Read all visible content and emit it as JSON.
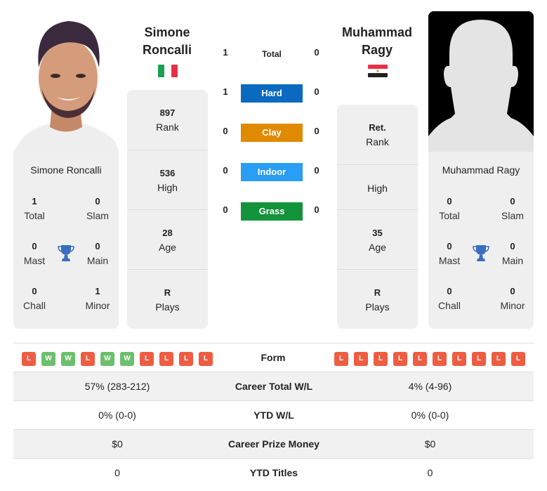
{
  "player1": {
    "name_line1": "Simone",
    "name_line2": "Roncalli",
    "full_name": "Simone Roncalli",
    "flag": "italy-flag",
    "photo": "player-photo",
    "rank": {
      "value": "897",
      "label": "Rank"
    },
    "high": {
      "value": "536",
      "label": "High"
    },
    "age": {
      "value": "28",
      "label": "Age"
    },
    "plays": {
      "value": "R",
      "label": "Plays"
    },
    "titles": {
      "total": {
        "value": "1",
        "label": "Total"
      },
      "slam": {
        "value": "0",
        "label": "Slam"
      },
      "mast": {
        "value": "0",
        "label": "Mast"
      },
      "main": {
        "value": "0",
        "label": "Main"
      },
      "chall": {
        "value": "0",
        "label": "Chall"
      },
      "minor": {
        "value": "1",
        "label": "Minor"
      }
    },
    "form": [
      "L",
      "W",
      "W",
      "L",
      "W",
      "W",
      "L",
      "L",
      "L",
      "L"
    ]
  },
  "player2": {
    "name_line1": "Muhammad",
    "name_line2": "Ragy",
    "full_name": "Muhammad Ragy",
    "flag": "egypt-flag",
    "photo": "silhouette-placeholder",
    "rank": {
      "value": "Ret.",
      "label": "Rank"
    },
    "high": {
      "value": "",
      "label": "High"
    },
    "age": {
      "value": "35",
      "label": "Age"
    },
    "plays": {
      "value": "R",
      "label": "Plays"
    },
    "titles": {
      "total": {
        "value": "0",
        "label": "Total"
      },
      "slam": {
        "value": "0",
        "label": "Slam"
      },
      "mast": {
        "value": "0",
        "label": "Mast"
      },
      "main": {
        "value": "0",
        "label": "Main"
      },
      "chall": {
        "value": "0",
        "label": "Chall"
      },
      "minor": {
        "value": "0",
        "label": "Minor"
      }
    },
    "form": [
      "L",
      "L",
      "L",
      "L",
      "L",
      "L",
      "L",
      "L",
      "L",
      "L"
    ]
  },
  "h2h": {
    "total": {
      "label": "Total",
      "p1": "1",
      "p2": "0"
    },
    "surfaces": [
      {
        "label": "Hard",
        "p1": "1",
        "p2": "0",
        "color": "#0a6abf"
      },
      {
        "label": "Clay",
        "p1": "0",
        "p2": "0",
        "color": "#e08a00"
      },
      {
        "label": "Indoor",
        "p1": "0",
        "p2": "0",
        "color": "#2a9df4"
      },
      {
        "label": "Grass",
        "p1": "0",
        "p2": "0",
        "color": "#13943a"
      }
    ]
  },
  "form_label": "Form",
  "comparison": [
    {
      "label": "Career Total W/L",
      "p1": "57% (283-212)",
      "p2": "4% (4-96)"
    },
    {
      "label": "YTD W/L",
      "p1": "0% (0-0)",
      "p2": "0% (0-0)"
    },
    {
      "label": "Career Prize Money",
      "p1": "$0",
      "p2": "$0"
    },
    {
      "label": "YTD Titles",
      "p1": "0",
      "p2": "0"
    }
  ],
  "colors": {
    "loss": "#ee5c42",
    "win": "#6cbf6c",
    "trophy": "#3a6fc0",
    "card_bg": "#efefef"
  }
}
